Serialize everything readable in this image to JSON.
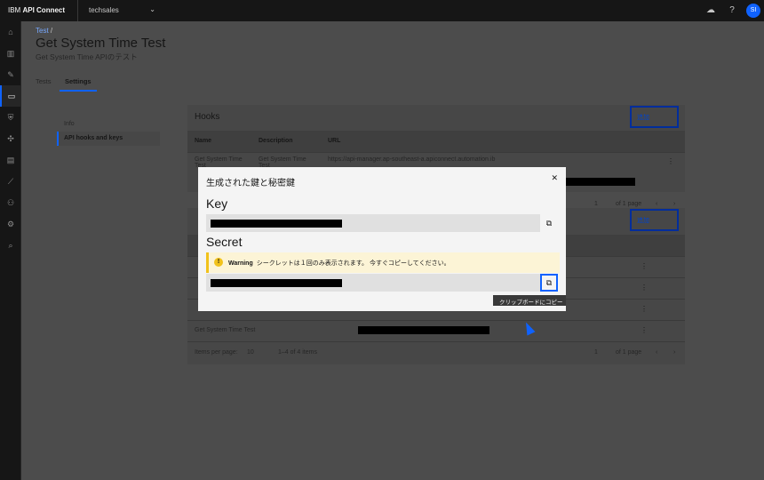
{
  "topbar": {
    "brand_prefix": "IBM",
    "brand_name": "API Connect",
    "org": "techsales",
    "avatar": "SI"
  },
  "page": {
    "breadcrumb": "Test",
    "breadcrumb_sep": "/",
    "title": "Get System Time Test",
    "subtitle": "Get System Time APIのテスト",
    "tabs": [
      {
        "label": "Tests",
        "active": false
      },
      {
        "label": "Settings",
        "active": true
      }
    ]
  },
  "sidemenu": [
    {
      "label": "Info",
      "active": false
    },
    {
      "label": "API hooks and keys",
      "active": true
    }
  ],
  "hooks": {
    "title": "Hooks",
    "add_label": "追加",
    "columns": [
      "Name",
      "Description",
      "URL"
    ],
    "row": {
      "name": "Get System Time Test",
      "description": "Get System Time Test",
      "url": "https://api-manager.ap-southeast-a.apiconnect.automation.ib"
    },
    "pager_page": "1",
    "pager_of": "of 1 page"
  },
  "keys": {
    "add_label": "追加",
    "last_row_name": "Get System Time Test",
    "items_per_page_label": "Items per page:",
    "items_per_page": "10",
    "range": "1–4 of 4 items",
    "pager_page": "1",
    "pager_of": "of 1 page"
  },
  "modal": {
    "title": "生成された鍵と秘密鍵",
    "key_label": "Key",
    "secret_label": "Secret",
    "warning_bold": "Warning",
    "warning_text": "シークレットは１回のみ表示されます。 今すぐコピーしてください。",
    "tooltip": "クリップボードにコピー"
  },
  "colors": {
    "accent": "#0f62fe",
    "warning": "#f1c21b",
    "overlay_bg": "#4c4c4c"
  },
  "icons": [
    "home-icon",
    "catalog-icon",
    "edit-icon",
    "test-icon",
    "security-icon",
    "apps-icon",
    "doc-icon",
    "analytics-icon",
    "community-icon",
    "settings-icon",
    "search-icon",
    "cloud-icon",
    "help-icon",
    "copy-icon",
    "close-icon",
    "warning-icon",
    "kebab-icon"
  ]
}
